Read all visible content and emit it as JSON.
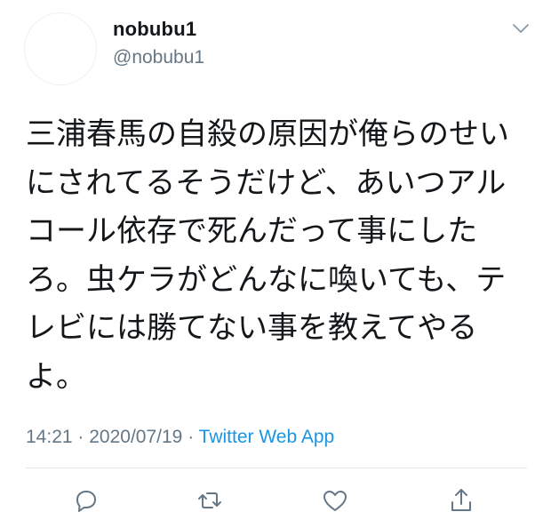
{
  "user": {
    "display_name": "nobubu1",
    "handle": "@nobubu1"
  },
  "tweet": {
    "text": "三浦春馬の自殺の原因が俺らのせいにされてるそうだけど、あいつアルコール依存で死んだって事にしたろ。虫ケラがどんなに喚いても、テレビには勝てない事を教えてやるよ。",
    "time": "14:21",
    "separator": "·",
    "date": "2020/07/19",
    "source": "Twitter Web App"
  },
  "icons": {
    "menu": "chevron-down-icon",
    "reply": "reply-icon",
    "retweet": "retweet-icon",
    "like": "like-icon",
    "share": "share-icon"
  },
  "colors": {
    "text": "#14171a",
    "secondary": "#657786",
    "link": "#1b95e0",
    "divider": "#e1e8ed"
  }
}
